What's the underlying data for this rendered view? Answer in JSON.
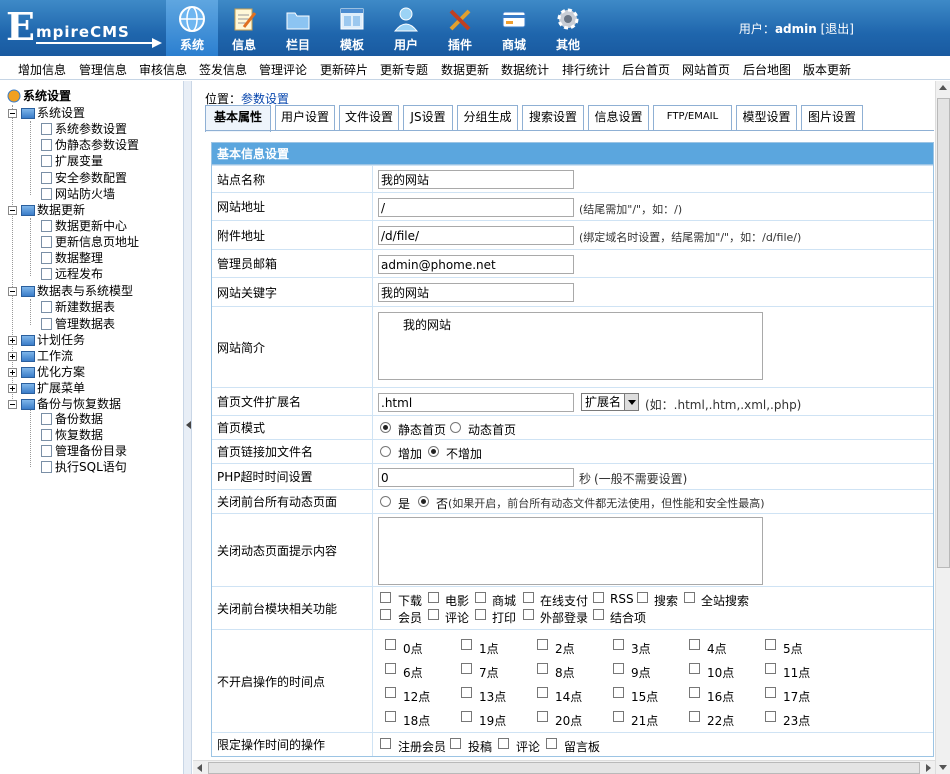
{
  "logo": {
    "first_letter": "E",
    "rest": "mpireCMS"
  },
  "nav": [
    {
      "label": "系统",
      "icon": "globe-icon",
      "active": true
    },
    {
      "label": "信息",
      "icon": "notepad-icon",
      "active": false
    },
    {
      "label": "栏目",
      "icon": "folder-icon",
      "active": false
    },
    {
      "label": "模板",
      "icon": "window-icon",
      "active": false
    },
    {
      "label": "用户",
      "icon": "user-icon",
      "active": false
    },
    {
      "label": "插件",
      "icon": "tools-icon",
      "active": false
    },
    {
      "label": "商城",
      "icon": "card-icon",
      "active": false
    },
    {
      "label": "其他",
      "icon": "gear-icon",
      "active": false
    }
  ],
  "userinfo": {
    "prefix": "用户：",
    "name": "admin",
    "logout": "[退出]"
  },
  "menubar": [
    "增加信息",
    "管理信息",
    "审核信息",
    "签发信息",
    "管理评论",
    "更新碎片",
    "更新专题",
    "数据更新",
    "数据统计",
    "排行统计",
    "后台首页",
    "网站首页",
    "后台地图",
    "版本更新"
  ],
  "sidebar": {
    "title": "系统设置",
    "groups": [
      {
        "label": "系统设置",
        "children": [
          "系统参数设置",
          "伪静态参数设置",
          "扩展变量",
          "安全参数配置",
          "网站防火墙"
        ]
      },
      {
        "label": "数据更新",
        "children": [
          "数据更新中心",
          "更新信息页地址",
          "数据整理",
          "远程发布"
        ]
      },
      {
        "label": "数据表与系统模型",
        "children": [
          "新建数据表",
          "管理数据表"
        ]
      },
      {
        "label": "计划任务",
        "children": []
      },
      {
        "label": "工作流",
        "children": []
      },
      {
        "label": "优化方案",
        "children": []
      },
      {
        "label": "扩展菜单",
        "children": []
      },
      {
        "label": "备份与恢复数据",
        "children": [
          "备份数据",
          "恢复数据",
          "管理备份目录",
          "执行SQL语句"
        ]
      }
    ]
  },
  "position": {
    "label": "位置：",
    "link": "参数设置"
  },
  "tabs": [
    "基本属性",
    "用户设置",
    "文件设置",
    "JS设置",
    "分组生成",
    "搜索设置",
    "信息设置",
    "FTP/EMAIL",
    "模型设置",
    "图片设置"
  ],
  "form": {
    "header": "基本信息设置",
    "site_name": {
      "label": "站点名称",
      "value": "我的网站"
    },
    "site_url": {
      "label": "网站地址",
      "value": "/",
      "hint": "(结尾需加\"/\"，如：/)"
    },
    "attach_url": {
      "label": "附件地址",
      "value": "/d/file/",
      "hint": "(绑定域名时设置，结尾需加\"/\"，如：/d/file/)"
    },
    "admin_email": {
      "label": "管理员邮箱",
      "value": "admin@phome.net"
    },
    "keywords": {
      "label": "网站关键字",
      "value": "我的网站"
    },
    "intro": {
      "label": "网站简介",
      "value": "我的网站"
    },
    "index_ext": {
      "label": "首页文件扩展名",
      "value": ".html",
      "select": "扩展名",
      "hint": "(如：.html,.htm,.xml,.php)"
    },
    "index_mode": {
      "label": "首页模式",
      "opt1": "静态首页",
      "opt2": "动态首页"
    },
    "index_link": {
      "label": "首页链接加文件名",
      "opt1": "增加",
      "opt2": "不增加"
    },
    "php_timeout": {
      "label": "PHP超时时间设置",
      "value": "0",
      "unit": "秒",
      "hint": "(一般不需要设置)"
    },
    "close_dynamic": {
      "label": "关闭前台所有动态页面",
      "opt1": "是",
      "opt2": "否",
      "hint": "(如果开启，前台所有动态文件都无法使用，但性能和安全性最高)"
    },
    "close_tip": {
      "label": "关闭动态页面提示内容",
      "value": ""
    },
    "close_modules": {
      "label": "关闭前台模块相关功能",
      "items": [
        "下载",
        "电影",
        "商城",
        "在线支付",
        "RSS",
        "搜索",
        "全站搜索",
        "会员",
        "评论",
        "打印",
        "外部登录",
        "结合项"
      ]
    },
    "closed_hours": {
      "label": "不开启操作的时间点",
      "items": [
        "0点",
        "1点",
        "2点",
        "3点",
        "4点",
        "5点",
        "6点",
        "7点",
        "8点",
        "9点",
        "10点",
        "11点",
        "12点",
        "13点",
        "14点",
        "15点",
        "16点",
        "17点",
        "18点",
        "19点",
        "20点",
        "21点",
        "22点",
        "23点"
      ]
    },
    "limit_ops": {
      "label": "限定操作时间的操作",
      "items": [
        "注册会员",
        "投稿",
        "评论",
        "留言板"
      ]
    }
  }
}
